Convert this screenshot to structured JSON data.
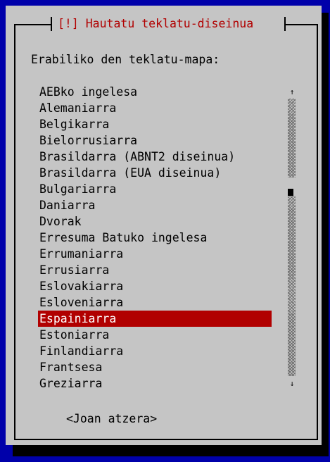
{
  "dialog": {
    "title": "[!] Hautatu teklatu-diseinua",
    "prompt": "Erabiliko den teklatu-mapa:",
    "items": [
      "AEBko ingelesa",
      "Alemaniarra",
      "Belgikarra",
      "Bielorrusiarra",
      "Brasildarra (ABNT2 diseinua)",
      "Brasildarra (EUA diseinua)",
      "Bulgariarra",
      "Daniarra",
      "Dvorak",
      "Erresuma Batuko ingelesa",
      "Errumaniarra",
      "Errusiarra",
      "Eslovakiarra",
      "Esloveniarra",
      "Espainiarra",
      "Estoniarra",
      "Finlandiarra",
      "Frantsesa",
      "Greziarra"
    ],
    "selected_item": "Espainiarra",
    "back_button": "<Joan atzera>"
  },
  "scrollbar": {
    "up_arrow": "↑",
    "down_arrow": "↓",
    "position": 0.34
  },
  "colors": {
    "background": "#0000aa",
    "dialog": "#c5c5c5",
    "accent": "#b10000",
    "selected_text": "#ffffff",
    "text": "#000000"
  },
  "icons": [
    "up-arrow-icon",
    "down-arrow-icon"
  ]
}
